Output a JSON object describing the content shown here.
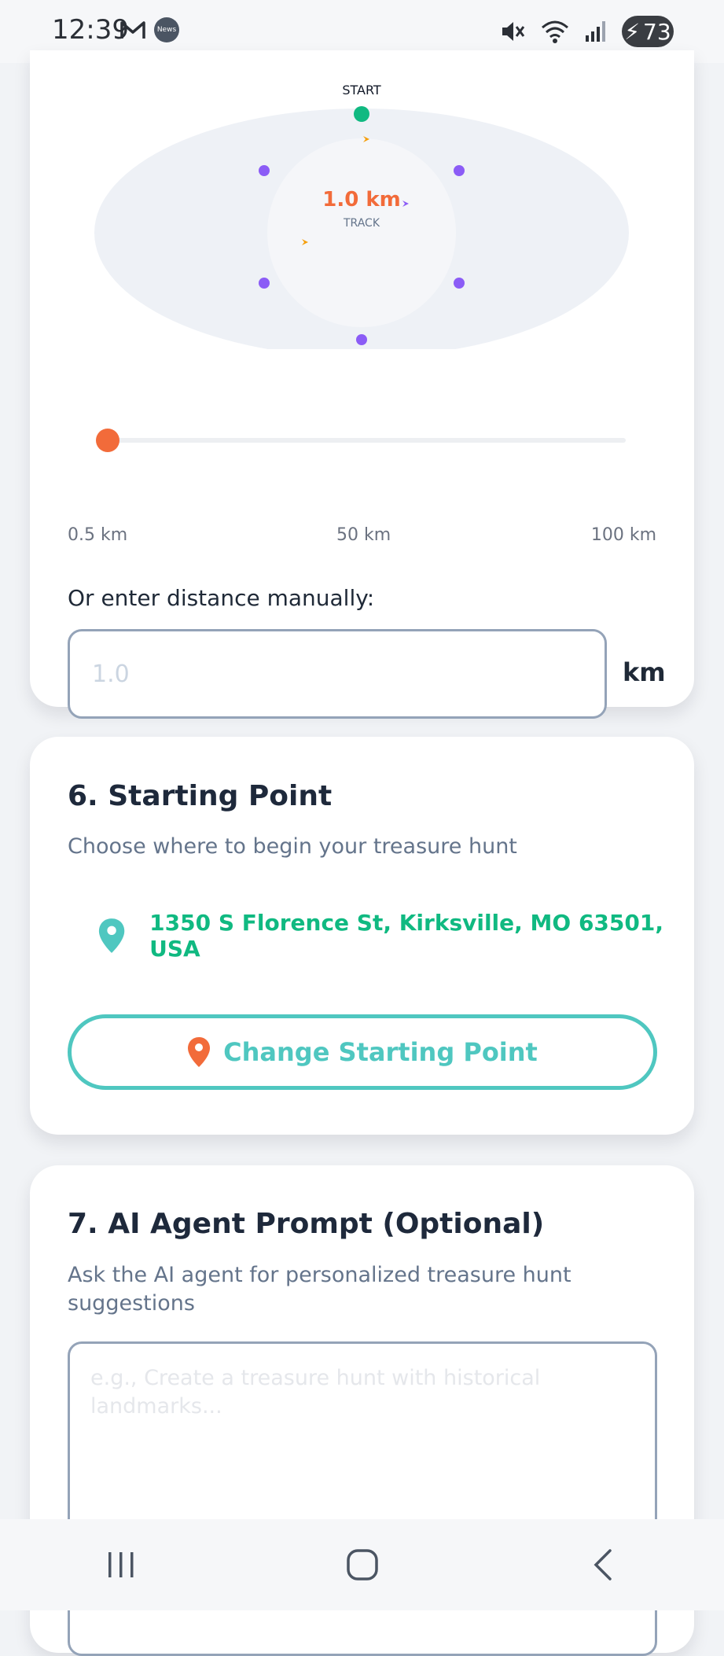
{
  "status_bar": {
    "time": "12:39",
    "news_badge": "News",
    "battery": "73",
    "icons": [
      "mail-icon",
      "news-icon",
      "mute-icon",
      "wifi-icon",
      "signal-icon",
      "battery-charging-icon"
    ]
  },
  "track": {
    "start_label": "START",
    "distance": "1.0 km",
    "track_label": "TRACK",
    "colors": {
      "start_dot": "#10b981",
      "waypoint_dot": "#8b5cf6",
      "distance_text": "#f26b3a",
      "ellipse": "#eef1f6"
    }
  },
  "slider": {
    "value_km": 1.0,
    "min_label": "0.5 km",
    "mid_label": "50 km",
    "max_label": "100 km"
  },
  "manual": {
    "label": "Or enter distance manually:",
    "placeholder": "1.0",
    "unit": "km"
  },
  "starting_point": {
    "title": "6. Starting Point",
    "subtitle": "Choose where to begin your treasure hunt",
    "address": "1350 S Florence St, Kirksville, MO 63501, USA",
    "button_label": "Change Starting Point",
    "accent": "#4fc7c0",
    "pin_color": "#f26b3a"
  },
  "ai_prompt": {
    "title": "7. AI Agent Prompt (Optional)",
    "subtitle": "Ask the AI agent for personalized treasure hunt suggestions",
    "placeholder": "e.g., Create a treasure hunt with historical landmarks..."
  },
  "nav": {
    "icons": [
      "recents-icon",
      "home-icon",
      "back-icon"
    ]
  }
}
